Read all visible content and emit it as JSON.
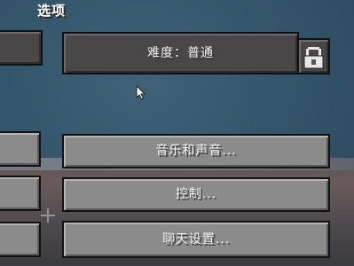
{
  "screen": {
    "title": "选项"
  },
  "difficulty": {
    "label": "难度：普通",
    "locked_icon": "lock-icon"
  },
  "buttons": {
    "music_sounds": "音乐和声音...",
    "controls": "控制...",
    "chat_settings": "聊天设置..."
  },
  "colors": {
    "background": "#34566b",
    "button_dark": "#4a4748",
    "button_light": "#8b8b8b",
    "text": "#f0f0f0"
  }
}
